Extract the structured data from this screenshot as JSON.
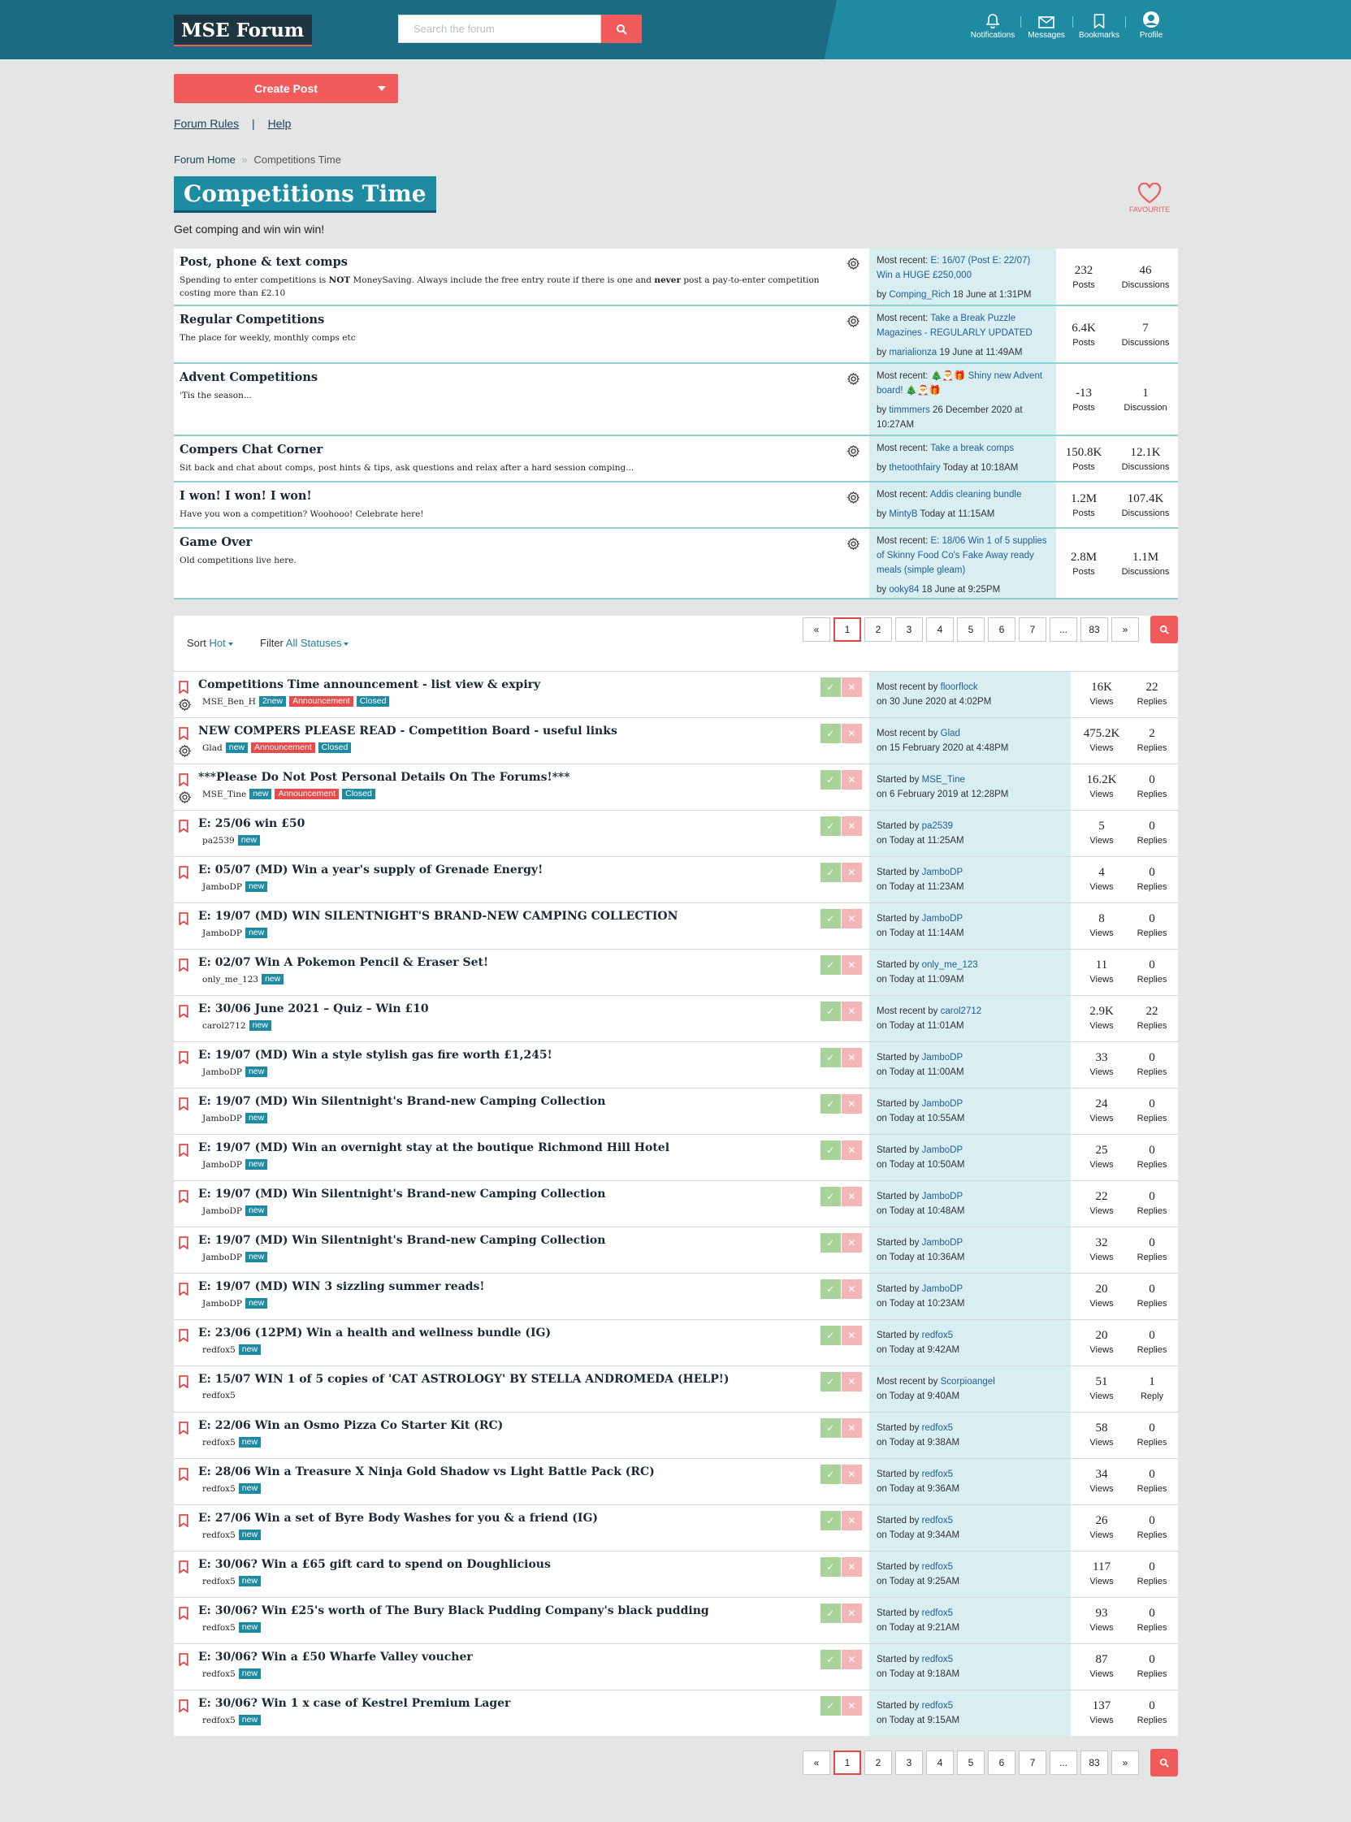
{
  "header": {
    "logo": "MSE Forum",
    "search_placeholder": "Search the forum",
    "nav": [
      {
        "icon": "bell-icon",
        "label": "Notifications"
      },
      {
        "icon": "envelope-icon",
        "label": "Messages"
      },
      {
        "icon": "bookmark-icon",
        "label": "Bookmarks"
      },
      {
        "icon": "avatar-icon",
        "label": "Profile"
      }
    ]
  },
  "actions": {
    "create_post": "Create Post",
    "forum_rules": "Forum Rules",
    "separator": "|",
    "help": "Help"
  },
  "breadcrumb": {
    "home": "Forum Home",
    "sep": "»",
    "current": "Competitions Time"
  },
  "page": {
    "title": "Competitions Time",
    "description": "Get comping and win win win!",
    "favourite": "FAVOURITE"
  },
  "categories": [
    {
      "name": "Post, phone & text comps",
      "desc_a": "Spending to enter competitions is ",
      "desc_b": "NOT",
      "desc_c": " MoneySaving. Always include the free entry route if there is one and ",
      "desc_d": "never",
      "desc_e": " post a pay-to-enter competition costing more than £2.10",
      "recent_label": "Most recent: ",
      "recent_title": "E: 16/07 (Post E: 22/07) Win a HUGE £250,000",
      "by": "by ",
      "user": "Comping_Rich",
      "when": " 18 June at 1:31PM",
      "posts": "232",
      "posts_label": "Posts",
      "disc": "46",
      "disc_label": "Discussions"
    },
    {
      "name": "Regular Competitions",
      "desc_a": "The place for weekly, monthly comps etc",
      "recent_label": "Most recent: ",
      "recent_title": "Take a Break Puzzle Magazines - REGULARLY UPDATED",
      "by": "by ",
      "user": "marialionza",
      "when": " 19 June at 11:49AM",
      "posts": "6.4K",
      "posts_label": "Posts",
      "disc": "7",
      "disc_label": "Discussions"
    },
    {
      "name": "Advent Competitions",
      "desc_a": "'Tis the season...",
      "recent_label": "Most recent: ",
      "recent_title": "🎄🎅🎁 Shiny new Advent board! 🎄🎅🎁",
      "by": "by ",
      "user": "timmmers",
      "when": " 26 December 2020 at 10:27AM",
      "posts": "-13",
      "posts_label": "Posts",
      "disc": "1",
      "disc_label": "Discussion"
    },
    {
      "name": "Compers Chat Corner",
      "desc_a": "Sit back and chat about comps, post hints & tips, ask questions and relax after a hard session comping...",
      "recent_label": "Most recent: ",
      "recent_title": "Take a break comps",
      "by": "by ",
      "user": "thetoothfairy",
      "when": " Today at 10:18AM",
      "posts": "150.8K",
      "posts_label": "Posts",
      "disc": "12.1K",
      "disc_label": "Discussions"
    },
    {
      "name": "I won! I won! I won!",
      "desc_a": "Have you won a competition? Woohooo! Celebrate here!",
      "recent_label": "Most recent: ",
      "recent_title": "Addis cleaning bundle",
      "by": "by ",
      "user": "MintyB",
      "when": " Today at 11:15AM",
      "posts": "1.2M",
      "posts_label": "Posts",
      "disc": "107.4K",
      "disc_label": "Discussions"
    },
    {
      "name": "Game Over",
      "desc_a": "Old competitions live here.",
      "recent_label": "Most recent: ",
      "recent_title": "E: 18/06 Win 1 of 5 supplies of Skinny Food Co's Fake Away ready meals (simple gleam)",
      "by": "by ",
      "user": "ooky84",
      "when": " 18 June at 9:25PM",
      "posts": "2.8M",
      "posts_label": "Posts",
      "disc": "1.1M",
      "disc_label": "Discussions"
    }
  ],
  "toolbar": {
    "sort_label": "Sort ",
    "sort_value": "Hot",
    "filter_label": "Filter ",
    "filter_value": "All Statuses"
  },
  "pagination": [
    "«",
    "1",
    "2",
    "3",
    "4",
    "5",
    "6",
    "7",
    "...",
    "83",
    "»"
  ],
  "topics": [
    {
      "title": "Competitions Time announcement - list view & expiry",
      "author": "MSE_Ben_H",
      "tags": [
        "2new",
        "Announcement",
        "Closed"
      ],
      "pinned": true,
      "action": "Most recent by ",
      "user": "floorflock",
      "when": "on 30 June 2020 at 4:02PM",
      "views": "16K",
      "replies": "22",
      "replies_label": "Replies"
    },
    {
      "title": "NEW COMPERS PLEASE READ - Competition Board - useful links",
      "author": "Glad",
      "tags": [
        "new",
        "Announcement",
        "Closed"
      ],
      "pinned": true,
      "action": "Most recent by ",
      "user": "Glad",
      "when": "on 15 February 2020 at 4:48PM",
      "views": "475.2K",
      "replies": "2",
      "replies_label": "Replies"
    },
    {
      "title": "***Please Do Not Post Personal Details On The Forums!***",
      "author": "MSE_Tine",
      "tags": [
        "new",
        "Announcement",
        "Closed"
      ],
      "pinned": true,
      "action": "Started by ",
      "user": "MSE_Tine",
      "when": "on 6 February 2019 at 12:28PM",
      "views": "16.2K",
      "replies": "0",
      "replies_label": "Replies"
    },
    {
      "title": "E: 25/06 win £50",
      "author": "pa2539",
      "tags": [
        "new"
      ],
      "action": "Started by ",
      "user": "pa2539",
      "when": "on Today at 11:25AM",
      "views": "5",
      "replies": "0",
      "replies_label": "Replies"
    },
    {
      "title": "E: 05/07 (MD) Win a year's supply of Grenade Energy!",
      "author": "JamboDP",
      "tags": [
        "new"
      ],
      "action": "Started by ",
      "user": "JamboDP",
      "when": "on Today at 11:23AM",
      "views": "4",
      "replies": "0",
      "replies_label": "Replies"
    },
    {
      "title": "E: 19/07 (MD) WIN SILENTNIGHT'S BRAND-NEW CAMPING COLLECTION",
      "author": "JamboDP",
      "tags": [
        "new"
      ],
      "action": "Started by ",
      "user": "JamboDP",
      "when": "on Today at 11:14AM",
      "views": "8",
      "replies": "0",
      "replies_label": "Replies"
    },
    {
      "title": "E: 02/07 Win A Pokemon Pencil & Eraser Set!",
      "author": "only_me_123",
      "tags": [
        "new"
      ],
      "action": "Started by ",
      "user": "only_me_123",
      "when": "on Today at 11:09AM",
      "views": "11",
      "replies": "0",
      "replies_label": "Replies"
    },
    {
      "title": "E: 30/06 June 2021 – Quiz – Win £10",
      "author": "carol2712",
      "tags": [
        "new"
      ],
      "action": "Most recent by ",
      "user": "carol2712",
      "when": "on Today at 11:01AM",
      "views": "2.9K",
      "replies": "22",
      "replies_label": "Replies"
    },
    {
      "title": "E: 19/07 (MD) Win a style stylish gas fire worth £1,245!",
      "author": "JamboDP",
      "tags": [
        "new"
      ],
      "action": "Started by ",
      "user": "JamboDP",
      "when": "on Today at 11:00AM",
      "views": "33",
      "replies": "0",
      "replies_label": "Replies"
    },
    {
      "title": "E: 19/07 (MD) Win Silentnight's Brand-new Camping Collection",
      "author": "JamboDP",
      "tags": [
        "new"
      ],
      "action": "Started by ",
      "user": "JamboDP",
      "when": "on Today at 10:55AM",
      "views": "24",
      "replies": "0",
      "replies_label": "Replies"
    },
    {
      "title": "E: 19/07 (MD) Win an overnight stay at the boutique Richmond Hill Hotel",
      "author": "JamboDP",
      "tags": [
        "new"
      ],
      "action": "Started by ",
      "user": "JamboDP",
      "when": "on Today at 10:50AM",
      "views": "25",
      "replies": "0",
      "replies_label": "Replies"
    },
    {
      "title": "E: 19/07 (MD) Win Silentnight's Brand-new Camping Collection",
      "author": "JamboDP",
      "tags": [
        "new"
      ],
      "action": "Started by ",
      "user": "JamboDP",
      "when": "on Today at 10:48AM",
      "views": "22",
      "replies": "0",
      "replies_label": "Replies"
    },
    {
      "title": "E: 19/07 (MD) Win Silentnight's Brand-new Camping Collection",
      "author": "JamboDP",
      "tags": [
        "new"
      ],
      "action": "Started by ",
      "user": "JamboDP",
      "when": "on Today at 10:36AM",
      "views": "32",
      "replies": "0",
      "replies_label": "Replies"
    },
    {
      "title": "E: 19/07 (MD) WIN 3 sizzling summer reads!",
      "author": "JamboDP",
      "tags": [
        "new"
      ],
      "action": "Started by ",
      "user": "JamboDP",
      "when": "on Today at 10:23AM",
      "views": "20",
      "replies": "0",
      "replies_label": "Replies"
    },
    {
      "title": "E: 23/06 (12PM) Win a health and wellness bundle (IG)",
      "author": "redfox5",
      "tags": [
        "new"
      ],
      "action": "Started by ",
      "user": "redfox5",
      "when": "on Today at 9:42AM",
      "views": "20",
      "replies": "0",
      "replies_label": "Replies"
    },
    {
      "title": "E: 15/07 WIN 1 of 5 copies of 'CAT ASTROLOGY' BY STELLA ANDROMEDA (HELP!)",
      "author": "redfox5",
      "tags": [],
      "action": "Most recent by ",
      "user": "Scorpioangel",
      "when": "on Today at 9:40AM",
      "views": "51",
      "replies": "1",
      "replies_label": "Reply"
    },
    {
      "title": "E: 22/06 Win an Osmo Pizza Co Starter Kit (RC)",
      "author": "redfox5",
      "tags": [
        "new"
      ],
      "action": "Started by ",
      "user": "redfox5",
      "when": "on Today at 9:38AM",
      "views": "58",
      "replies": "0",
      "replies_label": "Replies"
    },
    {
      "title": "E: 28/06 Win a Treasure X Ninja Gold Shadow vs Light Battle Pack (RC)",
      "author": "redfox5",
      "tags": [
        "new"
      ],
      "action": "Started by ",
      "user": "redfox5",
      "when": "on Today at 9:36AM",
      "views": "34",
      "replies": "0",
      "replies_label": "Replies"
    },
    {
      "title": "E: 27/06 Win a set of Byre Body Washes for you & a friend (IG)",
      "author": "redfox5",
      "tags": [
        "new"
      ],
      "action": "Started by ",
      "user": "redfox5",
      "when": "on Today at 9:34AM",
      "views": "26",
      "replies": "0",
      "replies_label": "Replies"
    },
    {
      "title": "E: 30/06? Win a £65 gift card to spend on Doughlicious",
      "author": "redfox5",
      "tags": [
        "new"
      ],
      "action": "Started by ",
      "user": "redfox5",
      "when": "on Today at 9:25AM",
      "views": "117",
      "replies": "0",
      "replies_label": "Replies"
    },
    {
      "title": "E: 30/06? Win £25's worth of The Bury Black Pudding Company's black pudding",
      "author": "redfox5",
      "tags": [
        "new"
      ],
      "action": "Started by ",
      "user": "redfox5",
      "when": "on Today at 9:21AM",
      "views": "93",
      "replies": "0",
      "replies_label": "Replies"
    },
    {
      "title": "E: 30/06? Win a £50 Wharfe Valley voucher",
      "author": "redfox5",
      "tags": [
        "new"
      ],
      "action": "Started by ",
      "user": "redfox5",
      "when": "on Today at 9:18AM",
      "views": "87",
      "replies": "0",
      "replies_label": "Replies"
    },
    {
      "title": "E: 30/06? Win 1 x case of Kestrel Premium Lager",
      "author": "redfox5",
      "tags": [
        "new"
      ],
      "action": "Started by ",
      "user": "redfox5",
      "when": "on Today at 9:15AM",
      "views": "137",
      "replies": "0",
      "replies_label": "Replies"
    }
  ],
  "labels": {
    "views": "Views",
    "vote_up": "✓",
    "vote_down": "✕"
  },
  "colors": {
    "header": "#1b6c83",
    "accent": "#1f8ba3",
    "red": "#f15b5b",
    "recent_bg": "#d8eef0"
  }
}
